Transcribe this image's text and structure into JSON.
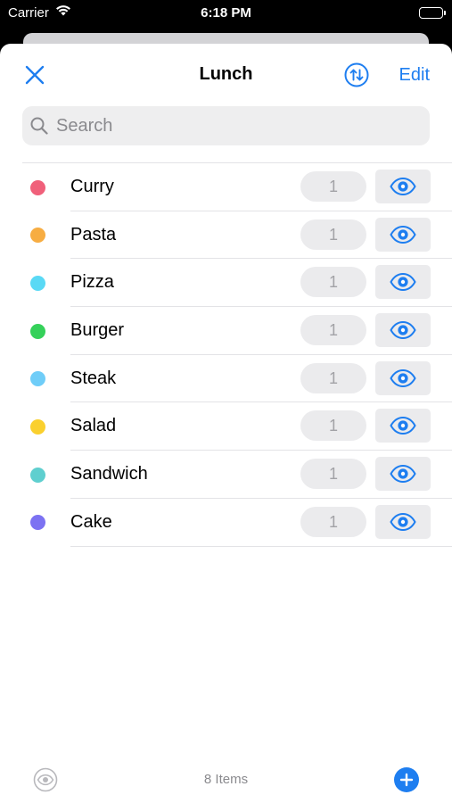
{
  "status_bar": {
    "carrier": "Carrier",
    "time": "6:18 PM"
  },
  "nav": {
    "title": "Lunch",
    "edit_label": "Edit"
  },
  "search": {
    "placeholder": "Search",
    "value": ""
  },
  "items": [
    {
      "name": "Curry",
      "count": "1",
      "color": "#f0607a"
    },
    {
      "name": "Pasta",
      "count": "1",
      "color": "#f7ad42"
    },
    {
      "name": "Pizza",
      "count": "1",
      "color": "#5ad9f5"
    },
    {
      "name": "Burger",
      "count": "1",
      "color": "#35d15a"
    },
    {
      "name": "Steak",
      "count": "1",
      "color": "#6fcdf8"
    },
    {
      "name": "Salad",
      "count": "1",
      "color": "#fad02e"
    },
    {
      "name": "Sandwich",
      "count": "1",
      "color": "#5fcfcf"
    },
    {
      "name": "Cake",
      "count": "1",
      "color": "#7c72f2"
    }
  ],
  "toolbar": {
    "count_label": "8 Items"
  },
  "colors": {
    "accent": "#1e7ef0",
    "secondary_text": "#8a8a8e",
    "pill_background": "#ebebed"
  },
  "icons": {
    "close": "close-icon",
    "sort": "sort-arrows-icon",
    "search": "search-icon",
    "visibility": "eye-icon",
    "add": "plus-icon"
  }
}
